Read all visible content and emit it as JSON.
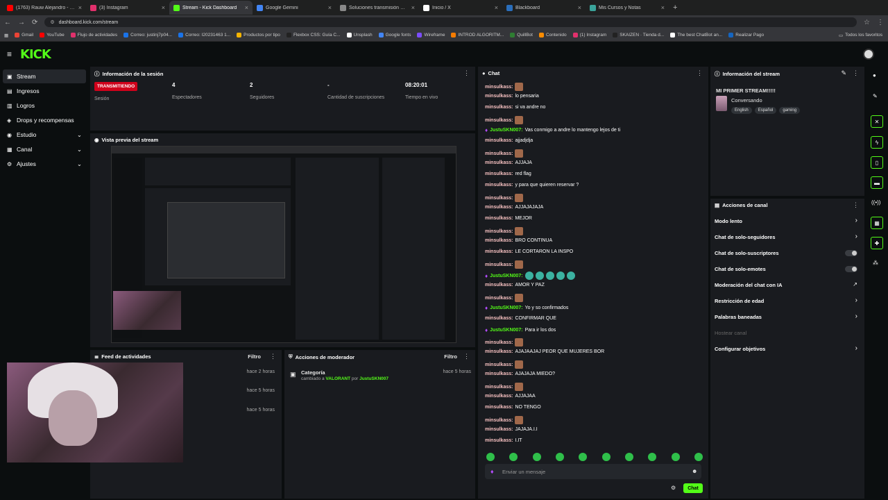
{
  "browser": {
    "tabs": [
      {
        "label": "(1763) Rauw Alejandro - QUÉ F",
        "color": "#ff0000"
      },
      {
        "label": "(3) Instagram",
        "color": "#e1306c"
      },
      {
        "label": "Stream - Kick Dashboard",
        "color": "#53fc18"
      },
      {
        "label": "Google Gemini",
        "color": "#4285f4"
      },
      {
        "label": "Soluciones transmisión OBS",
        "color": "#888888"
      },
      {
        "label": "Inicio / X",
        "color": "#ffffff"
      },
      {
        "label": "Blackboard",
        "color": "#2a6ebb"
      },
      {
        "label": "Mis Cursos y Notas",
        "color": "#3aa39a"
      }
    ],
    "url": "dashboard.kick.com/stream",
    "bookmarks": [
      "Gmail",
      "YouTube",
      "Flujo de actividades",
      "Correo: justinj7p04...",
      "Correo: I20231463 1...",
      "Productos por tipo",
      "Flexbox CSS: Guía C...",
      "Unsplash",
      "Google fonts",
      "Wireframe",
      "INTROD ALGORITM...",
      "QuillBot",
      "Contenido",
      "(1) Instagram",
      "SKAIZEN · Tienda d...",
      "The best ChatBot an...",
      "Realizar Pago"
    ],
    "bookmarks_right": "Todos los favoritos"
  },
  "kick": {
    "logo": "KICK"
  },
  "sidebar": {
    "items": [
      {
        "label": "Stream",
        "icon": "▣",
        "active": true,
        "chev": ""
      },
      {
        "label": "Ingresos",
        "icon": "▤",
        "active": false,
        "chev": ""
      },
      {
        "label": "Logros",
        "icon": "▥",
        "active": false,
        "chev": ""
      },
      {
        "label": "Drops y recompensas",
        "icon": "◈",
        "active": false,
        "chev": ""
      },
      {
        "label": "Estudio",
        "icon": "◉",
        "active": false,
        "chev": "⌄"
      },
      {
        "label": "Canal",
        "icon": "▦",
        "active": false,
        "chev": "⌄"
      },
      {
        "label": "Ajustes",
        "icon": "⚙",
        "active": false,
        "chev": "⌄"
      }
    ]
  },
  "session": {
    "title": "Información de la sesión",
    "status": "TRANSMITIENDO",
    "status_label": "Sesión",
    "viewers": "4",
    "viewers_label": "Espectadores",
    "followers": "2",
    "followers_label": "Seguidores",
    "subs": "-",
    "subs_label": "Cantidad de suscripciones",
    "live_time": "08:20:01",
    "live_label": "Tiempo en vivo"
  },
  "preview": {
    "title": "Vista previa del stream"
  },
  "feed": {
    "title": "Feed de actividades",
    "filter": "Filtro",
    "rows": [
      "hace 2 horas",
      "hace 5 horas",
      "hace 5 horas"
    ]
  },
  "modactions": {
    "title": "Acciones de moderador",
    "filter": "Filtro",
    "item_title": "Categoría",
    "item_prefix": "cambiado a",
    "item_value": "VALORANT",
    "item_by": "por",
    "item_user": "JustuSKN007",
    "item_time": "hace 5 horas"
  },
  "chat": {
    "title": "Chat",
    "messages": [
      {
        "user": "minsulkass:",
        "text": "",
        "emote": true,
        "mod": false
      },
      {
        "user": "minsulkass:",
        "text": "lo pensaria",
        "emote": false,
        "mod": false
      },
      {
        "user": "minsulkass:",
        "text": "si va andre no",
        "emote": false,
        "mod": false
      },
      {
        "user": "minsulkass:",
        "text": "",
        "emote": true,
        "mod": false
      },
      {
        "user": "JustuSKN007:",
        "text": "Vas conmigo a andre lo mantengo lejos de ti",
        "emote": false,
        "mod": true
      },
      {
        "user": "minsulkass:",
        "text": "ajjadjdja",
        "emote": false,
        "mod": false
      },
      {
        "user": "minsulkass:",
        "text": "",
        "emote": true,
        "mod": false
      },
      {
        "user": "minsulkass:",
        "text": "AJJAJA",
        "emote": false,
        "mod": false
      },
      {
        "user": "minsulkass:",
        "text": "red flag",
        "emote": false,
        "mod": false
      },
      {
        "user": "minsulkass:",
        "text": "y para que quieren reservar ?",
        "emote": false,
        "mod": false
      },
      {
        "user": "minsulkass:",
        "text": "",
        "emote": true,
        "mod": false
      },
      {
        "user": "minsulkass:",
        "text": "AJJAJAJAJA",
        "emote": false,
        "mod": false
      },
      {
        "user": "minsulkass:",
        "text": "MEJOR",
        "emote": false,
        "mod": false
      },
      {
        "user": "minsulkass:",
        "text": "",
        "emote": true,
        "mod": false
      },
      {
        "user": "minsulkass:",
        "text": "BRO CONTINUA",
        "emote": false,
        "mod": false
      },
      {
        "user": "minsulkass:",
        "text": "LE CORTARON LA INSPO",
        "emote": false,
        "mod": false
      },
      {
        "user": "minsulkass:",
        "text": "",
        "emote": true,
        "mod": false
      },
      {
        "user": "JustuSKN007:",
        "text": "",
        "emote": true,
        "mod": true
      },
      {
        "user": "minsulkass:",
        "text": "AMOR Y PAZ",
        "emote": false,
        "mod": false
      },
      {
        "user": "minsulkass:",
        "text": "",
        "emote": true,
        "mod": false
      },
      {
        "user": "JustuSKN007:",
        "text": "Yo y so confirmados",
        "emote": false,
        "mod": true
      },
      {
        "user": "minsulkass:",
        "text": "CONFIRMAR QUE",
        "emote": false,
        "mod": false
      },
      {
        "user": "JustuSKN007:",
        "text": "Para ir los dos",
        "emote": false,
        "mod": true
      },
      {
        "user": "minsulkass:",
        "text": "",
        "emote": true,
        "mod": false
      },
      {
        "user": "minsulkass:",
        "text": "AJAJAAJAJ PEOR QUE MUJERES BOR",
        "emote": false,
        "mod": false
      },
      {
        "user": "minsulkass:",
        "text": "",
        "emote": true,
        "mod": false
      },
      {
        "user": "minsulkass:",
        "text": "AJAJAJA MIEDO?",
        "emote": false,
        "mod": false
      },
      {
        "user": "minsulkass:",
        "text": "",
        "emote": true,
        "mod": false
      },
      {
        "user": "minsulkass:",
        "text": "AJJAJAA",
        "emote": false,
        "mod": false
      },
      {
        "user": "minsulkass:",
        "text": "NO TENGO",
        "emote": false,
        "mod": false
      },
      {
        "user": "minsulkass:",
        "text": "",
        "emote": true,
        "mod": false
      },
      {
        "user": "minsulkass:",
        "text": "JAJAJA.I.I",
        "emote": false,
        "mod": false
      },
      {
        "user": "minsulkass:",
        "text": "I.IT",
        "emote": false,
        "mod": false
      }
    ],
    "placeholder": "Enviar un mensaje",
    "send": "Chat"
  },
  "streaminfo": {
    "title": "Información del stream",
    "stream_title": "MI PRIMER STREAM!!!!!",
    "category": "Conversando",
    "tags": [
      "English",
      "Español",
      "gaming"
    ]
  },
  "channelactions": {
    "title": "Acciones de canal",
    "items": [
      {
        "label": "Modo lento",
        "type": "chevron"
      },
      {
        "label": "Chat de solo-seguidores",
        "type": "chevron"
      },
      {
        "label": "Chat de solo-suscriptores",
        "type": "toggle"
      },
      {
        "label": "Chat de solo-emotes",
        "type": "toggle"
      },
      {
        "label": "Moderación del chat con IA",
        "type": "external"
      },
      {
        "label": "Restricción de edad",
        "type": "chevron"
      },
      {
        "label": "Palabras baneadas",
        "type": "chevron"
      },
      {
        "label": "Hostear canal",
        "type": "disabled"
      },
      {
        "label": "Configurar objetivos",
        "type": "chevron"
      }
    ]
  }
}
